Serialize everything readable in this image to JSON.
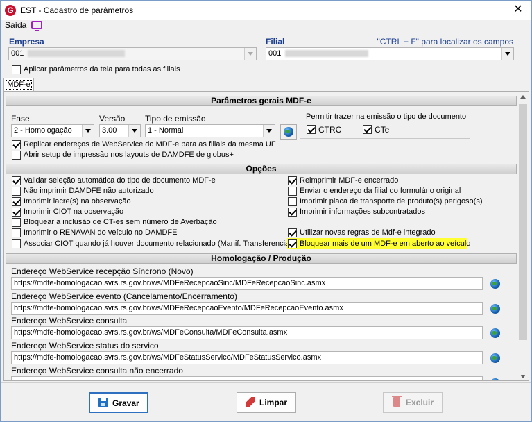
{
  "window": {
    "title": "EST - Cadastro de parâmetros",
    "close_label": "✕"
  },
  "menu": {
    "saida": "Saída"
  },
  "empresa": {
    "label": "Empresa",
    "value": "001"
  },
  "filial": {
    "label": "Filial",
    "value": "001"
  },
  "hint": "\"CTRL + F\" para localizar os campos",
  "aplicar_label": "Aplicar parâmetros da tela para todas as filiais",
  "tab_label": "MDF-e",
  "sections": {
    "gerais": "Parâmetros gerais MDF-e",
    "opcoes": "Opções",
    "homologacao": "Homologação / Produção"
  },
  "fase": {
    "label": "Fase",
    "value": "2 - Homologação"
  },
  "versao": {
    "label": "Versão",
    "value": "3.00"
  },
  "tipo_emissao": {
    "label": "Tipo de emissão",
    "value": "1 - Normal"
  },
  "permitir": {
    "title": "Permitir trazer na emissão o tipo de documento",
    "ctrc": "CTRC",
    "cte": "CTe"
  },
  "replicar": "Replicar endereços de WebService do MDF-e para as filiais da mesma UF",
  "abrir_setup": "Abrir setup de impressão nos layouts de DAMDFE de globus+",
  "opcoes_left": [
    {
      "label": "Validar seleção automática do tipo de documento MDF-e",
      "checked": true
    },
    {
      "label": "Não imprimir DAMDFE não autorizado",
      "checked": false
    },
    {
      "label": "Imprimir lacre(s) na observação",
      "checked": true
    },
    {
      "label": "Imprimir CIOT na observação",
      "checked": true
    },
    {
      "label": "Bloquear a inclusão de CT-es sem número de Averbação",
      "checked": false
    },
    {
      "label": "Imprimir o RENAVAN do veículo no DAMDFE",
      "checked": false
    },
    {
      "label": "Associar CIOT quando já houver documento relacionado (Manif. Transferencia)",
      "checked": false
    }
  ],
  "opcoes_right": [
    {
      "label": "Reimprimir MDF-e encerrado",
      "checked": true
    },
    {
      "label": "Enviar o endereço da filial do formulário original",
      "checked": false
    },
    {
      "label": "Imprimir placa de transporte de produto(s) perigoso(s)",
      "checked": false
    },
    {
      "label": "Imprimir informações subcontratados",
      "checked": true
    },
    {
      "label": "Utilizar novas regras de Mdf-e integrado",
      "checked": true
    },
    {
      "label": "Bloquear mais de um MDF-e em aberto ao veículo",
      "checked": true
    }
  ],
  "endpoints": [
    {
      "label": "Endereço WebService recepção Síncrono (Novo)",
      "url": "https://mdfe-homologacao.svrs.rs.gov.br/ws/MDFeRecepcaoSinc/MDFeRecepcaoSinc.asmx"
    },
    {
      "label": "Endereço WebService evento (Cancelamento/Encerramento)",
      "url": "https://mdfe-homologacao.svrs.rs.gov.br/ws/MDFeRecepcaoEvento/MDFeRecepcaoEvento.asmx"
    },
    {
      "label": "Endereço WebService consulta",
      "url": "https://mdfe-homologacao.svrs.rs.gov.br/ws/MDFeConsulta/MDFeConsulta.asmx"
    },
    {
      "label": "Endereço WebService status do servico",
      "url": "https://mdfe-homologacao.svrs.rs.gov.br/ws/MDFeStatusServico/MDFeStatusServico.asmx"
    },
    {
      "label": "Endereço WebService consulta não encerrado",
      "url": ""
    }
  ],
  "buttons": {
    "gravar": "Gravar",
    "limpar": "Limpar",
    "excluir": "Excluir"
  },
  "colors": {
    "highlight": "#ffff33",
    "label_blue": "#1a3d8f",
    "brand_red": "#c8102e"
  },
  "icons": [
    "app-logo-icon",
    "monitor-icon",
    "globe-icon",
    "save-icon",
    "eraser-icon",
    "trash-icon"
  ]
}
